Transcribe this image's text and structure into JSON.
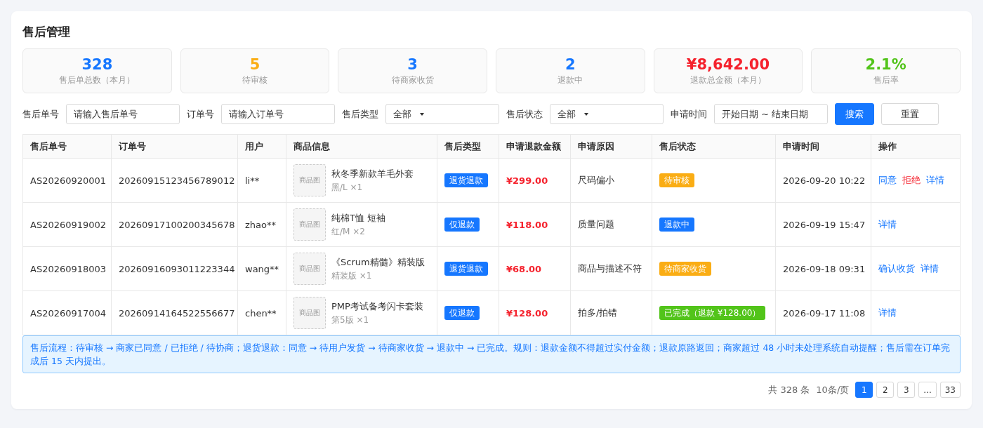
{
  "title": "售后管理",
  "stats": [
    {
      "value": "328",
      "label": "售后单总数（本月）",
      "color": "#1677ff"
    },
    {
      "value": "5",
      "label": "待审核",
      "color": "#faad14"
    },
    {
      "value": "3",
      "label": "待商家收货",
      "color": "#1677ff"
    },
    {
      "value": "2",
      "label": "退款中",
      "color": "#1677ff"
    },
    {
      "value": "¥8,642.00",
      "label": "退款总金额（本月）",
      "color": "#f5222d"
    },
    {
      "value": "2.1%",
      "label": "售后率",
      "color": "#52c41a"
    }
  ],
  "filters": [
    {
      "kind": "input",
      "label": "售后单号",
      "placeholder": "请输入售后单号"
    },
    {
      "kind": "input",
      "label": "订单号",
      "placeholder": "请输入订单号"
    },
    {
      "kind": "select",
      "label": "售后类型",
      "value": "全部"
    },
    {
      "kind": "select",
      "label": "售后状态",
      "value": "全部"
    },
    {
      "kind": "input",
      "label": "申请时间",
      "placeholder": "开始日期 ~ 结束日期"
    }
  ],
  "buttons": [
    {
      "kind": "primary",
      "label": "搜索"
    },
    {
      "kind": "default",
      "label": "重置"
    }
  ],
  "table": {
    "columns": [
      "售后单号",
      "订单号",
      "用户",
      "商品信息",
      "售后类型",
      "申请退款金额",
      "申请原因",
      "售后状态",
      "申请时间",
      "操作"
    ],
    "rows": [
      {
        "id": "AS20260920001",
        "order": "20260915123456789012",
        "user": "li**",
        "image": "商品图",
        "product": "秋冬季新款羊毛外套",
        "spec": "黑/L ×1",
        "type": "退货退款",
        "amount": "¥299.00",
        "reason": "尺码偏小",
        "status": {
          "label": "待审核",
          "color": "#faad14"
        },
        "time": "2026-09-20 10:22",
        "actions": [
          {
            "label": "同意",
            "kind": "link"
          },
          {
            "label": "拒绝",
            "kind": "danger"
          },
          {
            "label": "详情",
            "kind": "link"
          }
        ]
      },
      {
        "id": "AS20260919002",
        "order": "20260917100200345678",
        "user": "zhao**",
        "image": "商品图",
        "product": "纯棉T恤 短袖",
        "spec": "红/M ×2",
        "type": "仅退款",
        "amount": "¥118.00",
        "reason": "质量问题",
        "status": {
          "label": "退款中",
          "color": "#1677ff"
        },
        "time": "2026-09-19 15:47",
        "actions": [
          {
            "label": "详情",
            "kind": "link"
          }
        ]
      },
      {
        "id": "AS20260918003",
        "order": "20260916093011223344",
        "user": "wang**",
        "image": "商品图",
        "product": "《Scrum精髓》精装版",
        "spec": "精装版 ×1",
        "type": "退货退款",
        "amount": "¥68.00",
        "reason": "商品与描述不符",
        "status": {
          "label": "待商家收货",
          "color": "#faad14"
        },
        "time": "2026-09-18 09:31",
        "actions": [
          {
            "label": "确认收货",
            "kind": "link"
          },
          {
            "label": "详情",
            "kind": "link"
          }
        ]
      },
      {
        "id": "AS20260917004",
        "order": "20260914164522556677",
        "user": "chen**",
        "image": "商品图",
        "product": "PMP考试备考闪卡套装",
        "spec": "第5版 ×1",
        "type": "仅退款",
        "amount": "¥128.00",
        "reason": "拍多/拍错",
        "status": {
          "label": "已完成（退款 ¥128.00）",
          "color": "#52c41a"
        },
        "time": "2026-09-17 11:08",
        "actions": [
          {
            "label": "详情",
            "kind": "link"
          }
        ]
      }
    ]
  },
  "notice": "售后流程：待审核 → 商家已同意 / 已拒绝 / 待协商；退货退款：同意 → 待用户发货 → 待商家收货 → 退款中 → 已完成。规则：退款金额不得超过实付金额；退款原路返回；商家超过 48 小时未处理系统自动提醒；售后需在订单完成后 15 天内提出。",
  "pagination": {
    "total": "共 328 条",
    "page_size": "10条/页",
    "pages": [
      {
        "label": "1",
        "selected": true
      },
      {
        "label": "2",
        "selected": false
      },
      {
        "label": "3",
        "selected": false
      },
      {
        "label": "...",
        "selected": false
      },
      {
        "label": "33",
        "selected": false
      }
    ]
  }
}
